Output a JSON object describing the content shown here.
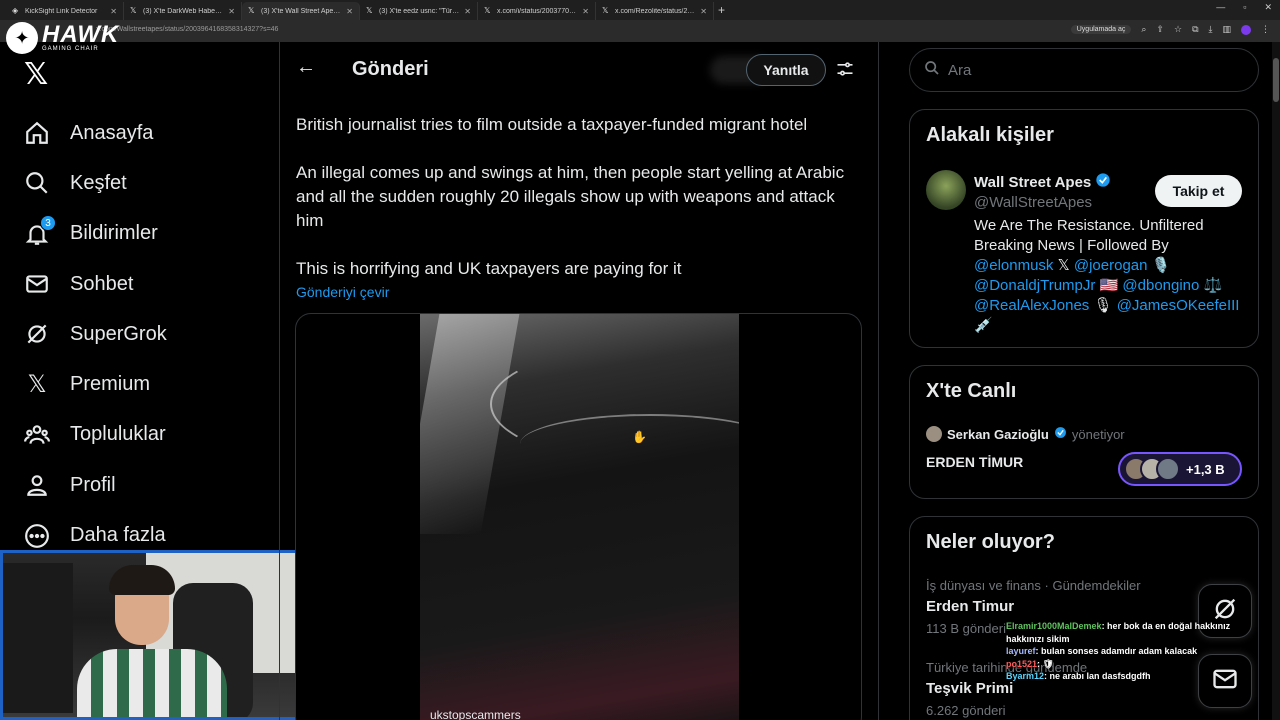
{
  "browser": {
    "tabs": [
      {
        "title": "KickSight Link Detector",
        "active": false
      },
      {
        "title": "(3) X'te DarkWeb Haberi: \"Irak'ı...",
        "active": false
      },
      {
        "title": "(3) X'te Wall Street Apes: \"Britis...",
        "active": true
      },
      {
        "title": "(3) X'te eedz usnc: \"Türkler asla i...",
        "active": false
      },
      {
        "title": "x.com/i/status/20037703908...",
        "active": false
      },
      {
        "title": "x.com/Rezolite/status/2002019...",
        "active": false
      }
    ],
    "new_tab": "+",
    "url": "x.com/Wallstreetapes/status/2003964168358314327?s=46",
    "open_in_app": "Uygulamada aç"
  },
  "overlay_logo": {
    "brand": "HAWK",
    "sub": "GAMING CHAIR"
  },
  "nav": {
    "items": [
      {
        "label": "Anasayfa",
        "icon": "home-icon"
      },
      {
        "label": "Keşfet",
        "icon": "search-icon"
      },
      {
        "label": "Bildirimler",
        "icon": "bell-icon",
        "badge": "3"
      },
      {
        "label": "Sohbet",
        "icon": "mail-icon"
      },
      {
        "label": "SuperGrok",
        "icon": "grok-icon"
      },
      {
        "label": "Premium",
        "icon": "x-icon"
      },
      {
        "label": "Topluluklar",
        "icon": "communities-icon"
      },
      {
        "label": "Profil",
        "icon": "profile-icon"
      },
      {
        "label": "Daha fazla",
        "icon": "more-icon"
      }
    ]
  },
  "post": {
    "header_title": "Gönderi",
    "reply_button": "Yanıtla",
    "text_1": "British journalist tries to film outside a taxpayer-funded migrant hotel",
    "text_2": "An illegal comes up and swings at him, then people start yelling at Arabic and all the sudden roughly 20 illegals show up with weapons and attack him",
    "text_3": "This is horrifying and UK taxpayers are paying for it",
    "translate": "Gönderiyi çevir",
    "video_watermark": "ukstopscammers"
  },
  "search": {
    "placeholder": "Ara"
  },
  "relevant_people": {
    "title": "Alakalı kişiler",
    "name": "Wall Street Apes",
    "handle": "@WallStreetApes",
    "follow_button": "Takip et",
    "bio_plain": "We Are The Resistance. Unfiltered Breaking News | Followed By",
    "mentions": [
      "@elonmusk",
      "@joerogan",
      "@DonaldjTrumpJr",
      "@dbongino",
      "@RealAlexJones",
      "@JamesOKeefeIII"
    ],
    "bio_emoji_1": "𝕏",
    "bio_emoji_2": "🎙️",
    "bio_emoji_3": "🇺🇸",
    "bio_emoji_4": "⚖️",
    "bio_emoji_5": "🎙",
    "bio_emoji_6": "💉"
  },
  "live": {
    "title": "X'te Canlı",
    "host": "Serkan Gazioğlu",
    "host_role": "yönetiyor",
    "space_title": "ERDEN TİMUR",
    "listeners": "+1,3 B"
  },
  "trends": {
    "title": "Neler oluyor?",
    "items": [
      {
        "meta": "İş dünyası ve finans · Gündemdekiler",
        "name": "Erden Timur",
        "count": "113 B gönderi"
      },
      {
        "meta": "Türkiye tarihinde gündemde",
        "name": "Teşvik Primi",
        "count": "6.262 gönderi"
      }
    ]
  },
  "chat": {
    "messages": [
      {
        "user": "Elramir1000MalDemek",
        "text": ": her bok da en doğal hakkınız hakkınızı sikim"
      },
      {
        "user": "layuref",
        "text": ": bulan sonses adamdır adam kalacak"
      },
      {
        "user": "po1521",
        "text": ": 🛡"
      },
      {
        "user": "Byarm12",
        "text": ": ne arabı lan dasfsdgdfh"
      }
    ]
  },
  "colors": {
    "accent": "#1d9bf0",
    "background": "#000000",
    "border": "#2f3336",
    "muted": "#71767b",
    "live_accent": "#7856ff"
  }
}
